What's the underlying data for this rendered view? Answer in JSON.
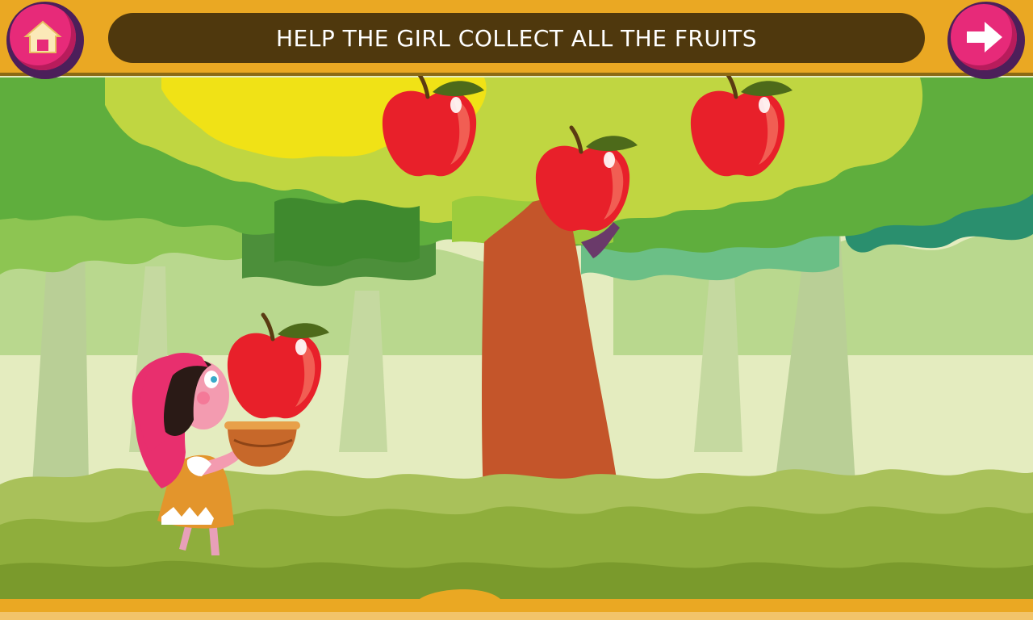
{
  "header": {
    "instruction": "HELP THE GIRL COLLECT ALL THE FRUITS"
  },
  "controls": {
    "home_icon": "home-icon",
    "next_icon": "right-arrow-icon"
  },
  "game": {
    "fruit_type": "apple",
    "apples_on_tree": 3,
    "apples_in_play": 1
  },
  "colors": {
    "header_bar": "#eaa823",
    "title_pill": "#4f380d",
    "button_pink": "#e72a79",
    "button_rim": "#4c1f5a",
    "apple_red": "#e8202a"
  }
}
